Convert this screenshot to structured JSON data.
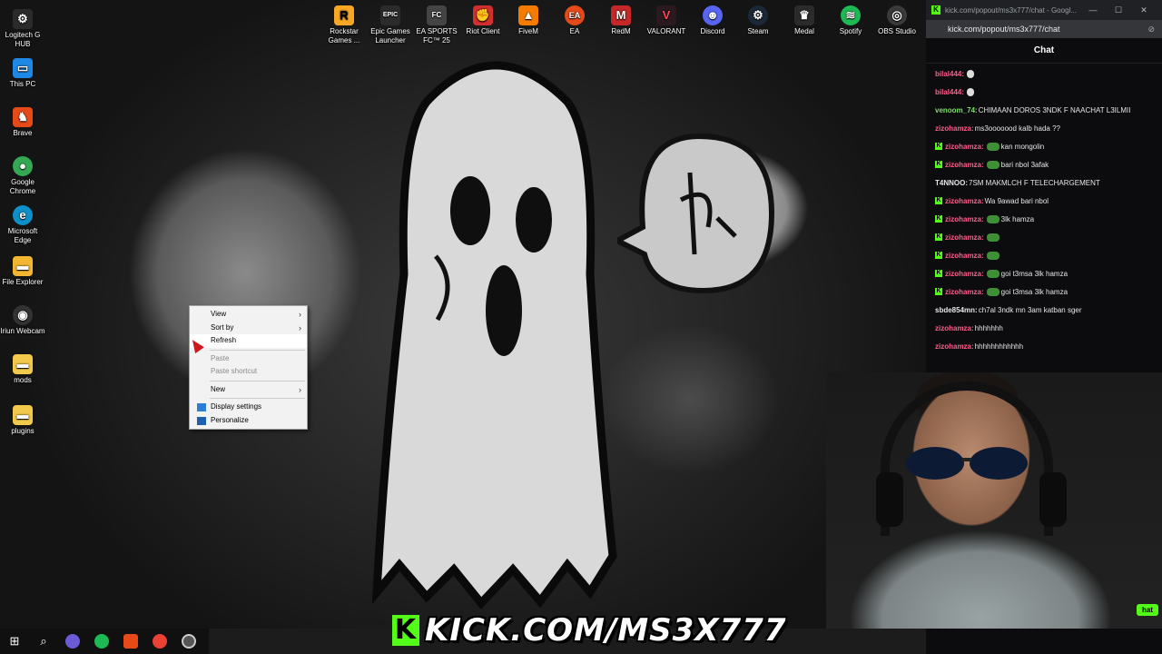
{
  "desktop_icons_left": [
    {
      "label": "Logitech G HUB",
      "icon": "logitech-icon",
      "color": "#2b2b2b"
    },
    {
      "label": "This PC",
      "icon": "computer-icon",
      "color": "#1e88e5"
    },
    {
      "label": "Brave",
      "icon": "brave-icon",
      "color": "#e64a19"
    },
    {
      "label": "Google Chrome",
      "icon": "chrome-icon",
      "color": "#34a853"
    },
    {
      "label": "Microsoft Edge",
      "icon": "edge-icon",
      "color": "#0f8fc9"
    },
    {
      "label": "File Explorer",
      "icon": "folder-icon",
      "color": "#f2b632"
    },
    {
      "label": "Iriun Webcam",
      "icon": "webcam-icon",
      "color": "#333333"
    },
    {
      "label": "mods",
      "icon": "folder-icon",
      "color": "#f2c94c"
    },
    {
      "label": "plugins",
      "icon": "folder-icon",
      "color": "#f2c94c"
    }
  ],
  "desktop_icons_top": [
    {
      "label": "Rockstar Games ...",
      "icon": "rockstar-icon",
      "color": "#f9a825"
    },
    {
      "label": "Epic Games Launcher",
      "icon": "epic-icon",
      "color": "#2b2b2b"
    },
    {
      "label": "EA SPORTS FC™ 25",
      "icon": "fc25-icon",
      "color": "#444444"
    },
    {
      "label": "Riot Client",
      "icon": "riot-icon",
      "color": "#d32f2f"
    },
    {
      "label": "FiveM",
      "icon": "fivem-icon",
      "color": "#f57c00"
    },
    {
      "label": "EA",
      "icon": "ea-icon",
      "color": "#e64a19"
    },
    {
      "label": "RedM",
      "icon": "redm-icon",
      "color": "#c62828"
    },
    {
      "label": "VALORANT",
      "icon": "valorant-icon",
      "color": "#2a1a1f"
    },
    {
      "label": "Discord",
      "icon": "discord-icon",
      "color": "#5865f2"
    },
    {
      "label": "Steam",
      "icon": "steam-icon",
      "color": "#1b2838"
    },
    {
      "label": "Medal",
      "icon": "medal-icon",
      "color": "#2b2b2b"
    },
    {
      "label": "Spotify",
      "icon": "spotify-icon",
      "color": "#1db954"
    },
    {
      "label": "OBS Studio",
      "icon": "obs-icon",
      "color": "#3a3a3a"
    }
  ],
  "context_menu": {
    "view": "View",
    "sort_by": "Sort by",
    "refresh": "Refresh",
    "paste": "Paste",
    "paste_shortcut": "Paste shortcut",
    "new": "New",
    "display_settings": "Display settings",
    "personalize": "Personalize"
  },
  "browser": {
    "title": "kick.com/popout/ms3x777/chat - Googl...",
    "url": "kick.com/popout/ms3x777/chat",
    "chat_header": "Chat"
  },
  "chat_messages": [
    {
      "badge": false,
      "user": "bilal444:",
      "user_color": "#ff5c8a",
      "emote": "white",
      "text": ""
    },
    {
      "badge": false,
      "user": "bilal444:",
      "user_color": "#ff5c8a",
      "emote": "white",
      "text": ""
    },
    {
      "badge": false,
      "user": "venoom_74:",
      "user_color": "#7ee06a",
      "emote": "",
      "text": "CHIMAAN DOROS 3NDK F NAACHAT L3ILMII"
    },
    {
      "badge": false,
      "user": "zizohamza:",
      "user_color": "#ff5c8a",
      "emote": "",
      "text": "ms3ooooood kalb hada ??"
    },
    {
      "badge": true,
      "user": "zizohamza:",
      "user_color": "#ff5c8a",
      "emote": "green",
      "text": "kan mongolin"
    },
    {
      "badge": true,
      "user": "zizohamza:",
      "user_color": "#ff5c8a",
      "emote": "green",
      "text": "bari nbol 3afak"
    },
    {
      "badge": false,
      "user": "T4NNOO:",
      "user_color": "#e6e6e6",
      "emote": "",
      "text": "7SM MAKMLCH F TELECHARGEMENT"
    },
    {
      "badge": true,
      "user": "zizohamza:",
      "user_color": "#ff5c8a",
      "emote": "",
      "text": "Wa 9awad bari nbol"
    },
    {
      "badge": true,
      "user": "zizohamza:",
      "user_color": "#ff5c8a",
      "emote": "green",
      "text": "3lk hamza"
    },
    {
      "badge": true,
      "user": "zizohamza:",
      "user_color": "#ff5c8a",
      "emote": "green",
      "text": ""
    },
    {
      "badge": true,
      "user": "zizohamza:",
      "user_color": "#ff5c8a",
      "emote": "green",
      "text": ""
    },
    {
      "badge": true,
      "user": "zizohamza:",
      "user_color": "#ff5c8a",
      "emote": "green",
      "text": "goi t3msa 3lk hamza"
    },
    {
      "badge": true,
      "user": "zizohamza:",
      "user_color": "#ff5c8a",
      "emote": "green",
      "text": "goi t3msa 3lk hamza"
    },
    {
      "badge": false,
      "user": "sbde854mn:",
      "user_color": "#e6e6e6",
      "emote": "",
      "text": "ch7al 3ndk mn 3am katban sger"
    },
    {
      "badge": false,
      "user": "zizohamza:",
      "user_color": "#ff5c8a",
      "emote": "",
      "text": "hhhhhhh"
    },
    {
      "badge": false,
      "user": "zizohamza:",
      "user_color": "#ff5c8a",
      "emote": "",
      "text": "hhhhhhhhhhhh"
    }
  ],
  "webcam": {
    "chat_button": "hat"
  },
  "stream_banner": {
    "k": "K",
    "text": "KICK.COM/MS3X777"
  },
  "taskbar": [
    {
      "icon": "windows-start-icon"
    },
    {
      "icon": "search-icon"
    },
    {
      "icon": "app-icon"
    },
    {
      "icon": "spotify-icon"
    },
    {
      "icon": "brave-icon"
    },
    {
      "icon": "chrome-icon"
    },
    {
      "icon": "obs-icon"
    }
  ],
  "colors": {
    "kick_green": "#53fc18",
    "taskbar": "#101010",
    "menu_bg": "#f2f2f2"
  }
}
